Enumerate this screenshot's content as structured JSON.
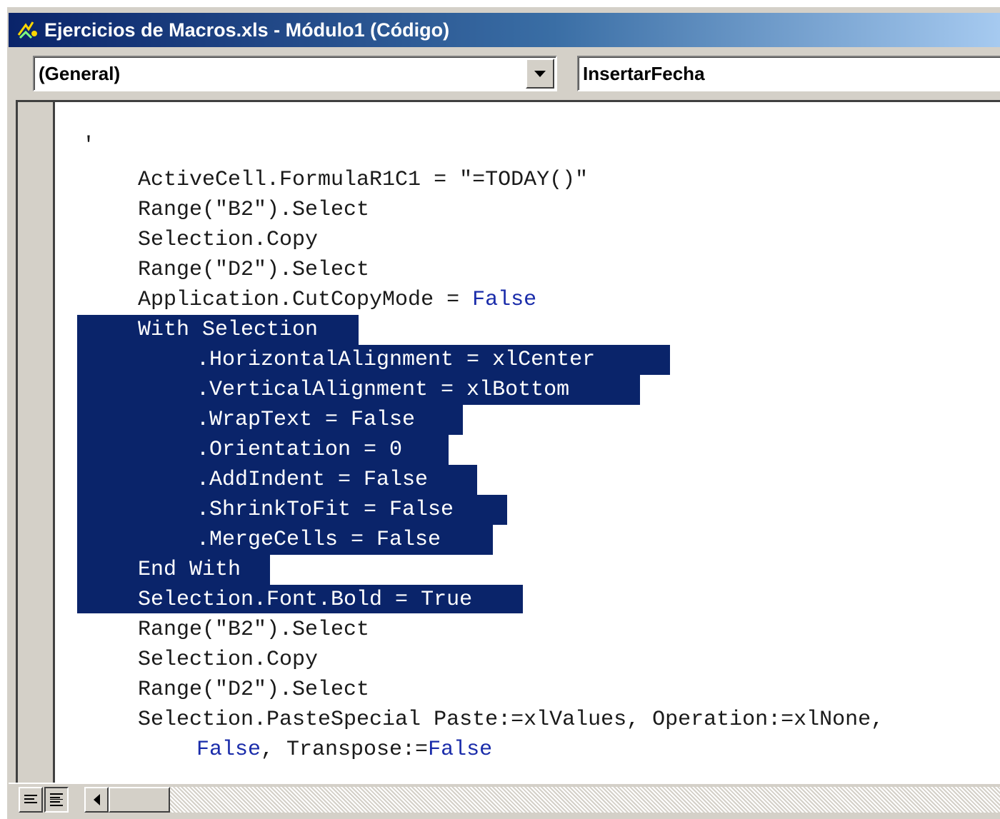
{
  "window": {
    "title": "Ejercicios de Macros.xls - Módulo1 (Código)",
    "icon": "vba-module-icon"
  },
  "selectors": {
    "object": "(General)",
    "procedure": "InsertarFecha"
  },
  "colors": {
    "selection_bg": "#0a246a",
    "keyword": "#1a2caa",
    "title_gradient_start": "#0a246a",
    "title_gradient_end": "#a6caf0"
  },
  "code": {
    "lines": [
      {
        "text": "'",
        "selected": false
      },
      {
        "text": "ActiveCell.FormulaR1C1 = \"=TODAY()\"",
        "selected": false
      },
      {
        "text": "Range(\"B2\").Select",
        "selected": false
      },
      {
        "text": "Selection.Copy",
        "selected": false
      },
      {
        "text": "Range(\"D2\").Select",
        "selected": false
      },
      {
        "text": "Application.CutCopyMode = False",
        "selected": false
      },
      {
        "text": "With Selection",
        "selected": true
      },
      {
        "text": ".HorizontalAlignment = xlCenter",
        "selected": true
      },
      {
        "text": ".VerticalAlignment = xlBottom",
        "selected": true
      },
      {
        "text": ".WrapText = False",
        "selected": true
      },
      {
        "text": ".Orientation = 0",
        "selected": true
      },
      {
        "text": ".AddIndent = False",
        "selected": true
      },
      {
        "text": ".ShrinkToFit = False",
        "selected": true
      },
      {
        "text": ".MergeCells = False",
        "selected": true
      },
      {
        "text": "End With",
        "selected": true
      },
      {
        "text": "Selection.Font.Bold = True",
        "selected": true
      },
      {
        "text": "Range(\"B2\").Select",
        "selected": false
      },
      {
        "text": "Selection.Copy",
        "selected": false
      },
      {
        "text": "Range(\"D2\").Select",
        "selected": false
      },
      {
        "text": "Selection.PasteSpecial Paste:=xlValues, Operation:=xlNone,",
        "selected": false
      },
      {
        "text": "False, Transpose:=False",
        "selected": false
      }
    ]
  },
  "bottom": {
    "procedure_view_icon": "procedure-view-icon",
    "full_module_view_icon": "full-module-view-icon"
  }
}
